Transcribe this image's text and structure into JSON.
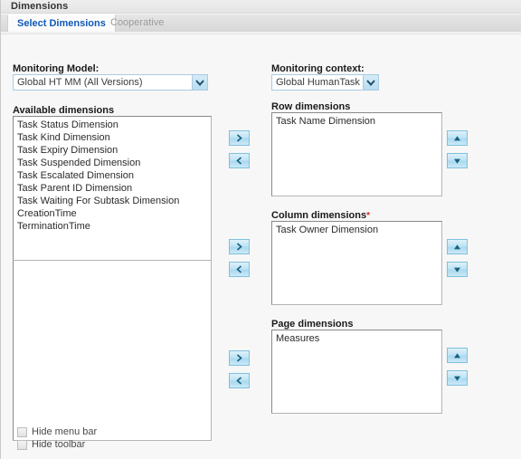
{
  "window": {
    "title": "Dimensions"
  },
  "tabs": [
    {
      "label": "Select Dimensions",
      "active": true
    },
    {
      "label": "Cooperative",
      "active": false
    }
  ],
  "fields": {
    "monitoring_model": {
      "label": "Monitoring Model:",
      "value": "Global HT MM (All Versions)"
    },
    "monitoring_context": {
      "label": "Monitoring context:",
      "value": "Global HumanTask"
    }
  },
  "available": {
    "label": "Available dimensions",
    "items": [
      "Task Status Dimension",
      "Task Kind Dimension",
      "Task Expiry Dimension",
      "Task Suspended Dimension",
      "Task Escalated Dimension",
      "Task Parent ID Dimension",
      "Task Waiting For Subtask Dimension",
      "CreationTime",
      "TerminationTime"
    ]
  },
  "row_dimensions": {
    "label": "Row dimensions",
    "required_marker": "",
    "items": [
      "Task Name Dimension"
    ]
  },
  "column_dimensions": {
    "label": "Column dimensions",
    "required_marker": "*",
    "items": [
      "Task Owner Dimension"
    ]
  },
  "page_dimensions": {
    "label": "Page dimensions",
    "required_marker": "",
    "items": [
      "Measures"
    ]
  },
  "transfer_buttons": {
    "add": {
      "icon": "chevron-right-icon",
      "glyph": "›"
    },
    "remove": {
      "icon": "chevron-left-icon",
      "glyph": "‹"
    }
  },
  "order_buttons": {
    "up": {
      "icon": "triangle-up-icon"
    },
    "down": {
      "icon": "triangle-down-icon"
    }
  },
  "options": [
    {
      "label": "Hide menu bar",
      "checked": false
    },
    {
      "label": "Hide toolbar",
      "checked": false
    }
  ],
  "colors": {
    "accent_tab_active": "#1059b8",
    "required_star": "#d03020",
    "button_border": "#7fc0dd",
    "select_border": "#a9cbe3",
    "page_background": "#f7f7f7"
  }
}
